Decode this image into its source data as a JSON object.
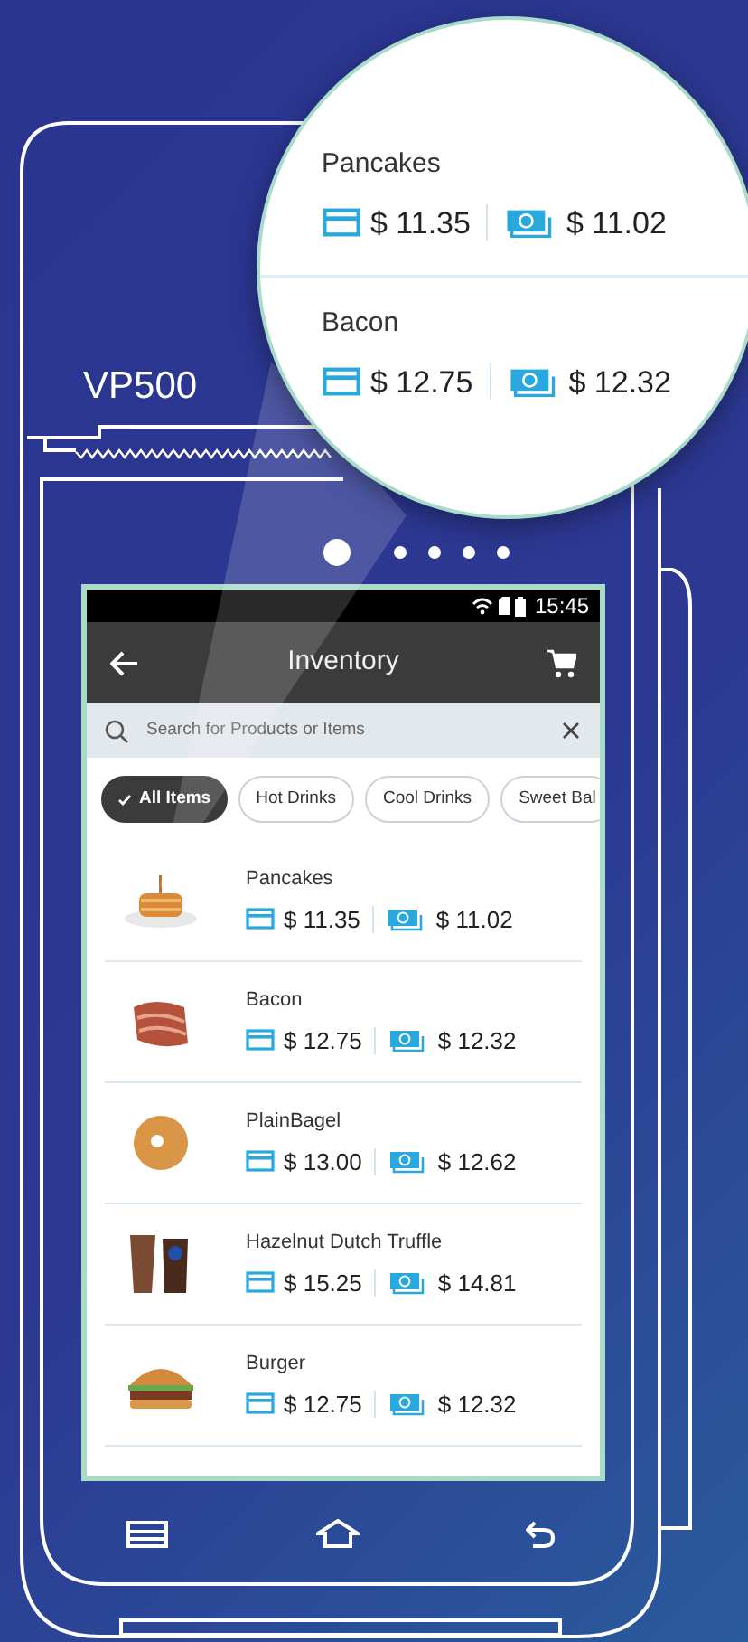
{
  "device": {
    "model": "VP500"
  },
  "page_dots": [
    {
      "selected": true
    },
    {
      "selected": false
    },
    {
      "selected": false
    },
    {
      "selected": false
    },
    {
      "selected": false
    }
  ],
  "magnifier": {
    "items": [
      {
        "name": "Pancakes",
        "card_price": "$ 11.35",
        "cash_price": "$ 11.02"
      },
      {
        "name": "Bacon",
        "card_price": "$ 12.75",
        "cash_price": "$ 12.32"
      }
    ]
  },
  "status_bar": {
    "time": "15:45"
  },
  "app_bar": {
    "title": "Inventory"
  },
  "search": {
    "placeholder": "Search for Products or Items"
  },
  "chips": [
    {
      "label": "All Items",
      "selected": true
    },
    {
      "label": "Hot Drinks",
      "selected": false
    },
    {
      "label": "Cool Drinks",
      "selected": false
    },
    {
      "label": "Sweet Bal",
      "selected": false
    }
  ],
  "products": [
    {
      "name": "Pancakes",
      "card_price": "$ 11.35",
      "cash_price": "$ 11.02",
      "kind": "pancakes"
    },
    {
      "name": "Bacon",
      "card_price": "$ 12.75",
      "cash_price": "$ 12.32",
      "kind": "bacon"
    },
    {
      "name": "PlainBagel",
      "card_price": "$ 13.00",
      "cash_price": "$ 12.62",
      "kind": "bagel"
    },
    {
      "name": "Hazelnut Dutch Truffle",
      "card_price": "$ 15.25",
      "cash_price": "$ 14.81",
      "kind": "drinks"
    },
    {
      "name": "Burger",
      "card_price": "$ 12.75",
      "cash_price": "$ 12.32",
      "kind": "burger"
    }
  ]
}
